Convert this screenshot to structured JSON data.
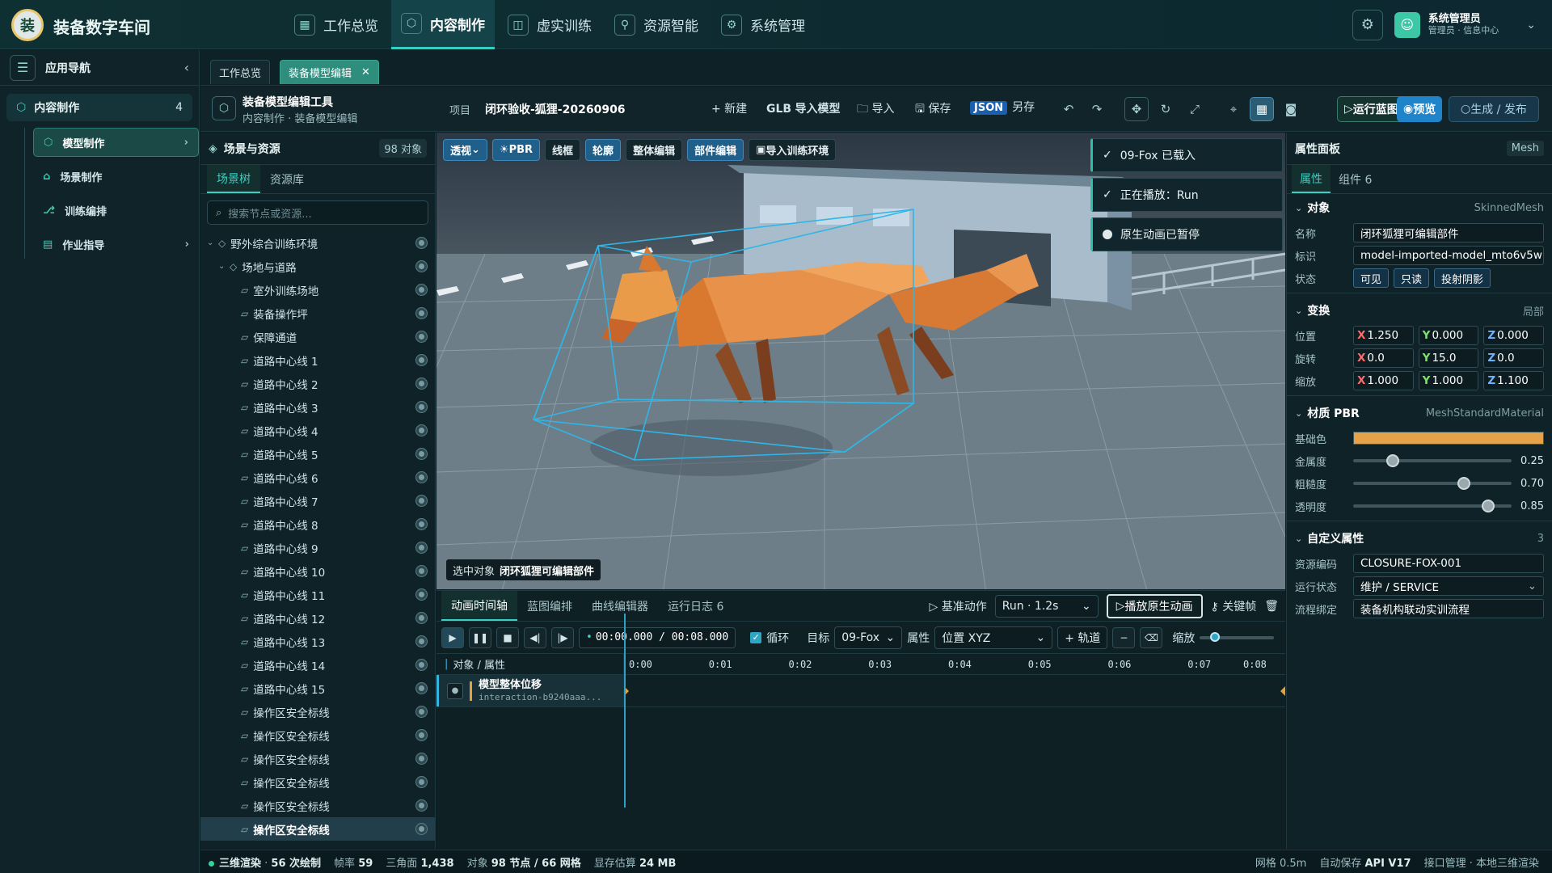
{
  "app": {
    "title": "装备数字车间",
    "logo_text": "装"
  },
  "topnav": [
    {
      "label": "工作总览",
      "icon": "grid-icon"
    },
    {
      "label": "内容制作",
      "icon": "cube-icon"
    },
    {
      "label": "虚实训练",
      "icon": "book-icon"
    },
    {
      "label": "资源智能",
      "icon": "plug-icon"
    },
    {
      "label": "系统管理",
      "icon": "gear-icon"
    }
  ],
  "user": {
    "name": "系统管理员",
    "role": "管理员 · 信息中心"
  },
  "sidebar": {
    "title": "应用导航",
    "group": {
      "label": "内容制作",
      "count": "4"
    },
    "items": [
      {
        "label": "模型制作"
      },
      {
        "label": "场景制作"
      },
      {
        "label": "训练编排"
      },
      {
        "label": "作业指导"
      }
    ]
  },
  "tabs": [
    {
      "label": "工作总览"
    },
    {
      "label": "装备模型编辑"
    }
  ],
  "toolbar": {
    "tool_title": "装备模型编辑工具",
    "crumb": "内容制作 · 装备模型编辑",
    "project_label": "项目",
    "project_name": "闭环验收-狐狸-20260906",
    "new": "+ 新建",
    "import_glb_prefix": "GLB",
    "import_glb": "导入模型",
    "import": "导入",
    "save": "保存",
    "json": "JSON",
    "save_as": "另存",
    "run": "运行蓝图",
    "preview": "预览",
    "publish": "生成 / 发布"
  },
  "scene": {
    "title": "场景与资源",
    "count": "98 对象",
    "tabs": [
      "场景树",
      "资源库"
    ],
    "search_placeholder": "搜索节点或资源...",
    "nodes": [
      {
        "label": "野外综合训练环境",
        "level": 0
      },
      {
        "label": "场地与道路",
        "level": 1
      },
      {
        "label": "室外训练场地",
        "level": 2
      },
      {
        "label": "装备操作坪",
        "level": 2
      },
      {
        "label": "保障通道",
        "level": 2
      },
      {
        "label": "道路中心线 1",
        "level": 2
      },
      {
        "label": "道路中心线 2",
        "level": 2
      },
      {
        "label": "道路中心线 3",
        "level": 2
      },
      {
        "label": "道路中心线 4",
        "level": 2
      },
      {
        "label": "道路中心线 5",
        "level": 2
      },
      {
        "label": "道路中心线 6",
        "level": 2
      },
      {
        "label": "道路中心线 7",
        "level": 2
      },
      {
        "label": "道路中心线 8",
        "level": 2
      },
      {
        "label": "道路中心线 9",
        "level": 2
      },
      {
        "label": "道路中心线 10",
        "level": 2
      },
      {
        "label": "道路中心线 11",
        "level": 2
      },
      {
        "label": "道路中心线 12",
        "level": 2
      },
      {
        "label": "道路中心线 13",
        "level": 2
      },
      {
        "label": "道路中心线 14",
        "level": 2
      },
      {
        "label": "道路中心线 15",
        "level": 2
      },
      {
        "label": "操作区安全标线",
        "level": 2
      },
      {
        "label": "操作区安全标线",
        "level": 2
      },
      {
        "label": "操作区安全标线",
        "level": 2
      },
      {
        "label": "操作区安全标线",
        "level": 2
      },
      {
        "label": "操作区安全标线",
        "level": 2
      },
      {
        "label": "操作区安全标线",
        "level": 2
      }
    ]
  },
  "viewport": {
    "buttons": [
      "透视",
      "PBR",
      "线框",
      "轮廓",
      "整体编辑",
      "部件编辑",
      "导入训练环境"
    ],
    "selected_label": "选中对象",
    "selected_name": "闭环狐狸可编辑部件"
  },
  "toasts": [
    {
      "text": "09-Fox 已载入"
    },
    {
      "text": "正在播放：Run"
    },
    {
      "text": "原生动画已暂停"
    }
  ],
  "timeline": {
    "tabs": [
      "动画时间轴",
      "蓝图编排",
      "曲线编辑器",
      "运行日志 6"
    ],
    "base_action": "基准动作",
    "clip": "Run · 1.2s",
    "play_native": "播放原生动画",
    "keyframe": "关键帧",
    "timecode": "00:00.000 / 00:08.000",
    "loop": "循环",
    "target_label": "目标",
    "target": "09-Fox",
    "attr_label": "属性",
    "attr": "位置 XYZ",
    "add_track": "+ 轨道",
    "zoom": "缩放",
    "zoom_value": 0.2,
    "track_header": "对象 / 属性",
    "ticks": [
      "0:00",
      "0:01",
      "0:02",
      "0:03",
      "0:04",
      "0:05",
      "0:06",
      "0:07",
      "0:08"
    ],
    "track": {
      "name": "模型整体位移",
      "id": "interaction-b9240aaa..."
    }
  },
  "props": {
    "title": "属性面板",
    "type": "Mesh",
    "tabs": [
      "属性",
      "组件 6"
    ],
    "object": {
      "head": "对象",
      "kind": "SkinnedMesh",
      "name_label": "名称",
      "name": "闭环狐狸可编辑部件",
      "id_label": "标识",
      "id": "model-imported-model_mto6v5w",
      "state_label": "状态",
      "chips": [
        "可见",
        "只读",
        "投射阴影"
      ]
    },
    "transform": {
      "head": "变换",
      "scope": "局部",
      "rows": [
        {
          "label": "位置",
          "x": "1.250",
          "y": "0.000",
          "z": "0.000"
        },
        {
          "label": "旋转",
          "x": "0.0",
          "y": "15.0",
          "z": "0.0"
        },
        {
          "label": "缩放",
          "x": "1.000",
          "y": "1.000",
          "z": "1.100"
        }
      ]
    },
    "material": {
      "head": "材质 PBR",
      "kind": "MeshStandardMaterial",
      "base_label": "基础色",
      "base_color": "#e6a24a",
      "sliders": [
        {
          "label": "金属度",
          "value": 0.25,
          "text": "0.25"
        },
        {
          "label": "粗糙度",
          "value": 0.7,
          "text": "0.70"
        },
        {
          "label": "透明度",
          "value": 0.85,
          "text": "0.85"
        }
      ]
    },
    "custom": {
      "head": "自定义属性",
      "count": "3",
      "rows": [
        {
          "label": "资源编码",
          "value": "CLOSURE-FOX-001"
        },
        {
          "label": "运行状态",
          "value": "维护 / SERVICE"
        },
        {
          "label": "流程绑定",
          "value": "装备机构联动实训流程"
        }
      ]
    }
  },
  "status": {
    "render": "三维渲染",
    "draws": "56 次绘制",
    "fps_label": "帧率",
    "fps": "59",
    "tri_label": "三角面",
    "tris": "1,438",
    "obj_label": "对象",
    "objs": "98 节点 / 66 网格",
    "mem_label": "显存估算",
    "mem": "24 MB",
    "grid": "网格 0.5m",
    "autosave": "自动保存",
    "api": "API V17",
    "iface": "接口管理 · 本地三维渲染"
  },
  "colors": {
    "accent": "#35d0c2",
    "brand": "#0f3033",
    "fox": "#e6a24a"
  }
}
